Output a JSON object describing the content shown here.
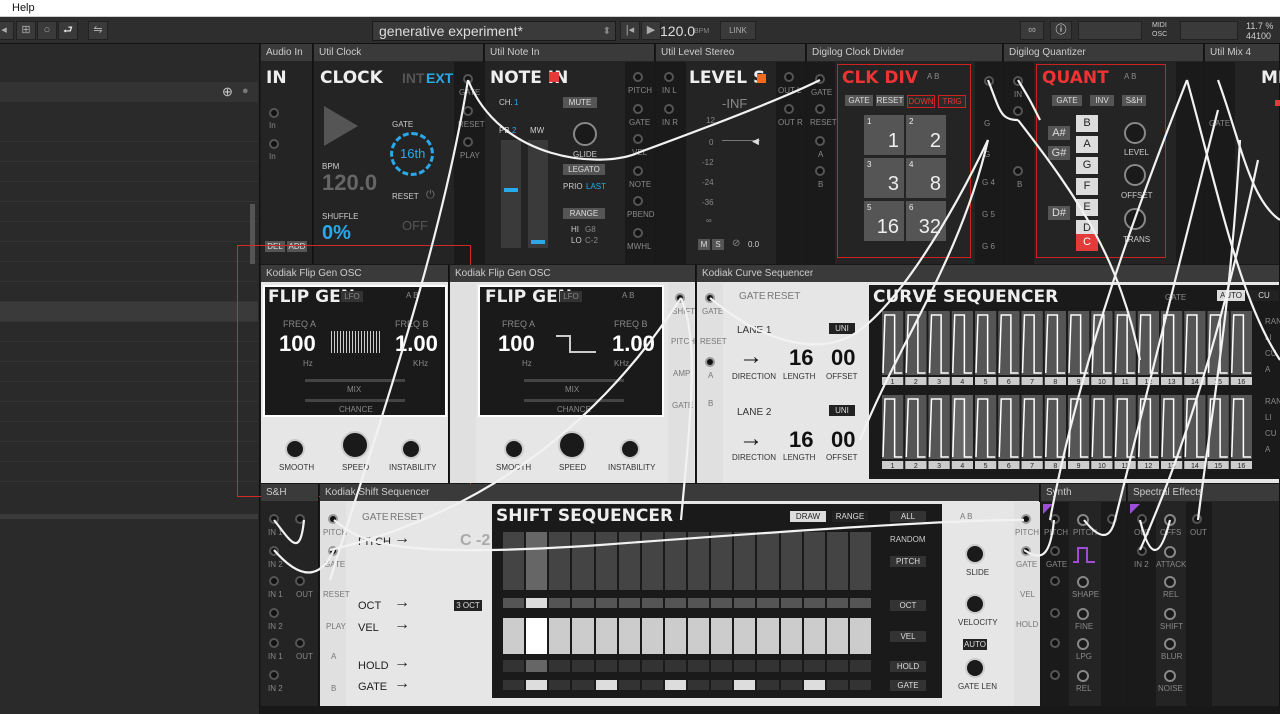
{
  "menubar": {
    "help": "Help"
  },
  "toolbar": {
    "project_name": "generative experiment*",
    "tempo": "120.0",
    "bpm_unit": "BPM",
    "link": "LINK",
    "midi": "MIDI",
    "osc": "OSC",
    "cpu": "11.7 %",
    "sample_rate": "44100"
  },
  "modules": {
    "audio_in": {
      "header": "Audio In",
      "title": "IN",
      "in1": "In",
      "in2": "In",
      "del": "DEL",
      "add": "ADD"
    },
    "clock": {
      "header": "Util Clock",
      "title": "CLOCK",
      "int": "INT",
      "ext": "EXT",
      "gate": "GATE",
      "gate_val": "16th",
      "bpm": "BPM",
      "bpm_val": "120.0",
      "reset": "RESET",
      "off": "OFF",
      "shuffle": "SHUFFLE",
      "shuffle_val": "0%",
      "out_gate": "GATE",
      "out_reset": "RESET",
      "out_play": "PLAY"
    },
    "note_in": {
      "header": "Util Note In",
      "title": "NOTE IN",
      "ch": "CH.",
      "ch_val": "1",
      "mute": "MUTE",
      "pb": "PB",
      "pb_val": "2",
      "mw": "MW",
      "glide": "GLIDE",
      "legato": "LEGATO",
      "prio": "PRIO",
      "prio_val": "LAST",
      "range": "RANGE",
      "hi": "HI",
      "hi_val": "G8",
      "lo": "LO",
      "lo_val": "C-2",
      "outs": [
        "PITCH",
        "GATE",
        "VEL",
        "NOTE",
        "PBEND",
        "MWHL"
      ]
    },
    "level": {
      "header": "Util Level Stereo",
      "title": "LEVEL S",
      "inf": "-INF",
      "scale": [
        "12",
        "0",
        "-12",
        "-24",
        "-36",
        "∞"
      ],
      "in_l": "IN L",
      "in_r": "IN R",
      "out_l": "OUT L",
      "out_r": "OUT R",
      "m": "M",
      "s": "S",
      "val": "0.0"
    },
    "clk_div": {
      "header": "Digilog Clock Divider",
      "title": "CLK DIV",
      "ab": "A B",
      "gate": "GATE",
      "reset": "RESET",
      "down": "DOWN",
      "trig": "TRIG",
      "in_gate": "GATE",
      "in_reset": "RESET",
      "in_a": "A",
      "in_b": "B",
      "pads": [
        {
          "n": "1",
          "v": "1"
        },
        {
          "n": "2",
          "v": "2"
        },
        {
          "n": "3",
          "v": "3"
        },
        {
          "n": "4",
          "v": "8"
        },
        {
          "n": "5",
          "v": "16"
        },
        {
          "n": "6",
          "v": "32"
        }
      ]
    },
    "quant": {
      "header": "Digilog Quantizer",
      "title": "QUANT",
      "ab": "A B",
      "gate": "GATE",
      "inv": "INV",
      "sh": "S&H",
      "outs": [
        "G",
        "G",
        "G 3",
        "G 4",
        "G 5",
        "G 6"
      ],
      "ins": [
        "IN",
        "C",
        "B"
      ],
      "notes": [
        "A#",
        "B",
        "A",
        "G#",
        "G",
        "F#",
        "F",
        "D#",
        "E",
        "D",
        "C#",
        "C"
      ],
      "level": "LEVEL",
      "offset": "OFFSET",
      "trans": "TRANS"
    },
    "mix4": {
      "header": "Util Mix 4",
      "title": "MIX",
      "gate": "GATE"
    },
    "flip1": {
      "header": "Kodiak Flip Gen OSC",
      "title": "FLIP GEN",
      "lfo": "LFO",
      "ab": "A B",
      "freq_a": "FREQ A",
      "freq_a_val": "100",
      "freq_a_unit": "Hz",
      "freq_b": "FREQ B",
      "freq_b_val": "1.00",
      "freq_b_unit": "KHz",
      "mix": "MIX",
      "chance": "CHANCE",
      "smooth": "SMOOTH",
      "speed": "SPEED",
      "instability": "INSTABILITY",
      "in_a": "A",
      "in_b": "B"
    },
    "flip2": {
      "header": "Kodiak Flip Gen OSC",
      "title": "FLIP GEN",
      "lfo": "LFO",
      "ab": "A B",
      "freq_a": "FREQ A",
      "freq_a_val": "100",
      "freq_a_unit": "Hz",
      "freq_b": "FREQ B",
      "freq_b_val": "1.00",
      "freq_b_unit": "KHz",
      "mix": "MIX",
      "chance": "CHANCE",
      "smooth": "SMOOTH",
      "speed": "SPEED",
      "instability": "INSTABILITY",
      "outs": [
        "SHIFT",
        "PITCH",
        "AMP",
        "GATE"
      ]
    },
    "curve": {
      "header": "Kodiak Curve Sequencer",
      "title": "CURVE SEQUENCER",
      "gate": "GATE",
      "reset": "RESET",
      "auto": "AUTO",
      "cu": "CU",
      "in_gate": "GATE",
      "in_reset": "RESET",
      "in_a": "A",
      "in_b": "B",
      "out_gate": "GATE",
      "lane1": {
        "label": "LANE 1",
        "uni": "UNI",
        "direction": "DIRECTION",
        "length": "LENGTH",
        "length_val": "16",
        "offset": "OFFSET",
        "offset_val": "00"
      },
      "lane2": {
        "label": "LANE 2",
        "uni": "UNI",
        "direction": "DIRECTION",
        "length": "LENGTH",
        "length_val": "16",
        "offset": "OFFSET",
        "offset_val": "00"
      },
      "steps": [
        "1",
        "2",
        "3",
        "4",
        "5",
        "6",
        "7",
        "8",
        "9",
        "10",
        "11",
        "12",
        "13",
        "14",
        "15",
        "16"
      ],
      "right_labels": [
        "RAN",
        "LI",
        "CU",
        "A",
        "RAN",
        "LI",
        "CU",
        "A"
      ]
    },
    "sh": {
      "header": "S&H",
      "ins": [
        "IN 1",
        "IN 2",
        "IN 1",
        "IN 2",
        "IN 1",
        "IN 2"
      ],
      "outs": [
        "OUT",
        "OUT"
      ]
    },
    "shift": {
      "header": "Kodiak Shift Sequencer",
      "title": "SHIFT SEQUENCER",
      "gate": "GATE",
      "reset": "RESET",
      "draw": "DRAW",
      "range": "RANGE",
      "all": "ALL",
      "random": "RANDOM",
      "pitch": "PITCH",
      "c2": "C -2",
      "oct": "OCT",
      "oct_val": "3 OCT",
      "vel": "VEL",
      "hold": "HOLD",
      "gatelbl": "GATE",
      "ab": "A B",
      "slide": "SLIDE",
      "velocity": "VELOCITY",
      "auto": "AUTO",
      "gate_len": "GATE LEN",
      "ins": [
        "PITCH",
        "GATE",
        "RESET",
        "PLAY",
        "A",
        "B"
      ],
      "outs": [
        "PITCH",
        "GATE",
        "VEL",
        "HOLD"
      ],
      "rows": [
        "PITCH",
        "OCT",
        "VEL",
        "HOLD",
        "GATE"
      ]
    },
    "synth": {
      "header": "Synth",
      "labels": [
        "PITCH",
        "GATE",
        "PITCH",
        "SHAPE",
        "FINE",
        "LPG",
        "REL"
      ]
    },
    "spectral": {
      "header": "Spectral Effects",
      "labels": [
        "OUT",
        "OFFS",
        "IN 1",
        "ATTACK",
        "REL",
        "SHIFT",
        "BLUR",
        "NOISE",
        "IN 2",
        "OUT"
      ]
    }
  },
  "accent": {
    "red": "#e33a3a",
    "blue": "#29a9e8",
    "purple": "#a04cd6",
    "selection": "#d02a2a"
  }
}
